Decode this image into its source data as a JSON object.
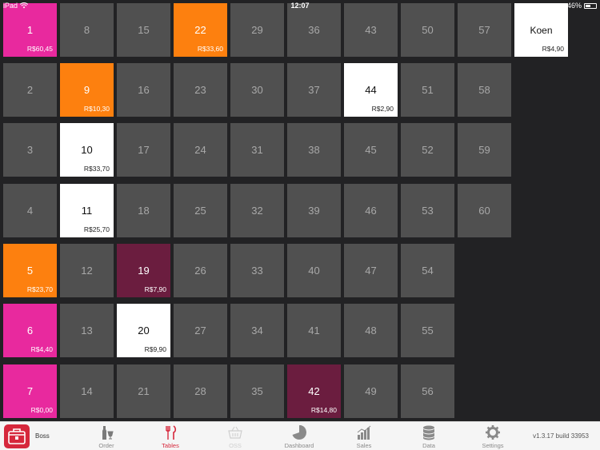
{
  "status_bar": {
    "carrier": "iPad",
    "time": "12:07",
    "battery": "46%"
  },
  "tables": {
    "columns": [
      [
        {
          "num": "1",
          "amount": "R$60,45",
          "color": "pink"
        },
        {
          "num": "2"
        },
        {
          "num": "3"
        },
        {
          "num": "4"
        },
        {
          "num": "5",
          "amount": "R$23,70",
          "color": "orange"
        },
        {
          "num": "6",
          "amount": "R$4,40",
          "color": "pink"
        },
        {
          "num": "7",
          "amount": "R$0,00",
          "color": "pink"
        }
      ],
      [
        {
          "num": "8"
        },
        {
          "num": "9",
          "amount": "R$10,30",
          "color": "orange"
        },
        {
          "num": "10",
          "amount": "R$33,70",
          "color": "white"
        },
        {
          "num": "11",
          "amount": "R$25,70",
          "color": "white"
        },
        {
          "num": "12"
        },
        {
          "num": "13"
        },
        {
          "num": "14"
        }
      ],
      [
        {
          "num": "15"
        },
        {
          "num": "16"
        },
        {
          "num": "17"
        },
        {
          "num": "18"
        },
        {
          "num": "19",
          "amount": "R$7,90",
          "color": "maroon"
        },
        {
          "num": "20",
          "amount": "R$9,90",
          "color": "white"
        },
        {
          "num": "21"
        }
      ],
      [
        {
          "num": "22",
          "amount": "R$33,60",
          "color": "orange"
        },
        {
          "num": "23"
        },
        {
          "num": "24"
        },
        {
          "num": "25"
        },
        {
          "num": "26"
        },
        {
          "num": "27"
        },
        {
          "num": "28"
        }
      ],
      [
        {
          "num": "29"
        },
        {
          "num": "30"
        },
        {
          "num": "31"
        },
        {
          "num": "32"
        },
        {
          "num": "33"
        },
        {
          "num": "34"
        },
        {
          "num": "35"
        }
      ],
      [
        {
          "num": "36"
        },
        {
          "num": "37"
        },
        {
          "num": "38"
        },
        {
          "num": "39"
        },
        {
          "num": "40"
        },
        {
          "num": "41"
        },
        {
          "num": "42",
          "amount": "R$14,80",
          "color": "maroon"
        }
      ],
      [
        {
          "num": "43"
        },
        {
          "num": "44",
          "amount": "R$2,90",
          "color": "white"
        },
        {
          "num": "45"
        },
        {
          "num": "46"
        },
        {
          "num": "47"
        },
        {
          "num": "48"
        },
        {
          "num": "49"
        }
      ],
      [
        {
          "num": "50"
        },
        {
          "num": "51"
        },
        {
          "num": "52"
        },
        {
          "num": "53"
        },
        {
          "num": "54"
        },
        {
          "num": "55"
        },
        {
          "num": "56"
        }
      ],
      [
        {
          "num": "57"
        },
        {
          "num": "58"
        },
        {
          "num": "59"
        },
        {
          "num": "60"
        }
      ],
      [
        {
          "num": "Koen",
          "amount": "R$4,90",
          "color": "white",
          "named": true
        }
      ]
    ]
  },
  "tabbar": {
    "brand_label": "Boss",
    "tabs": [
      {
        "label": "Order",
        "icon": "bottle-glass-icon",
        "state": "normal"
      },
      {
        "label": "Tables",
        "icon": "fork-knife-icon",
        "state": "active"
      },
      {
        "label": "OSS",
        "icon": "basket-icon",
        "state": "disabled"
      },
      {
        "label": "Dashboard",
        "icon": "pie-chart-icon",
        "state": "normal"
      },
      {
        "label": "Sales",
        "icon": "bar-chart-icon",
        "state": "normal"
      },
      {
        "label": "Data",
        "icon": "database-icon",
        "state": "normal"
      },
      {
        "label": "Settings",
        "icon": "gear-icon",
        "state": "normal"
      }
    ],
    "version": "v1.3.17 build 33953"
  },
  "colors": {
    "pink": "#e8299e",
    "orange": "#fd800f",
    "maroon": "#6b1d3f",
    "tile": "#505050",
    "accent": "#d6283c"
  }
}
